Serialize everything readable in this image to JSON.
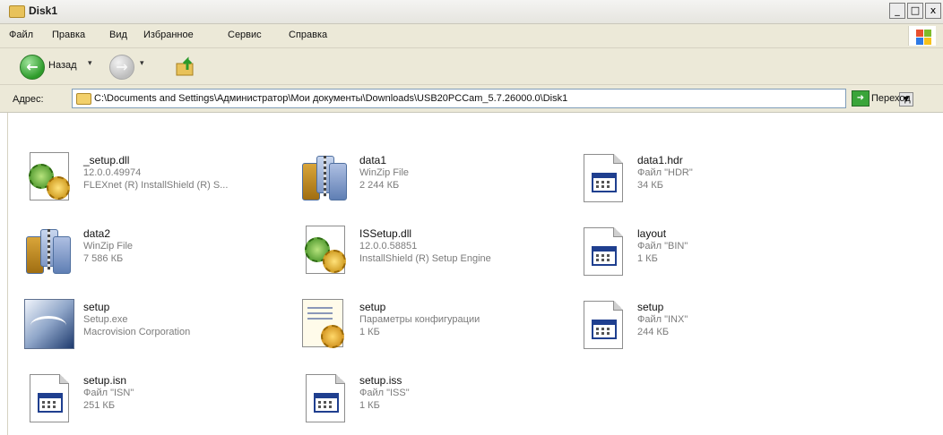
{
  "window": {
    "title": "Disk1",
    "buttons": {
      "minimize": "_",
      "maximize": "□",
      "close": "x"
    }
  },
  "menu": {
    "items": [
      "Файл",
      "Правка",
      "Вид",
      "Избранное",
      "Сервис",
      "Справка"
    ]
  },
  "toolbar": {
    "back_label": "Назад",
    "back_dropdown": "▾",
    "forward_dropdown": "▾"
  },
  "address": {
    "label": "Адрес:",
    "path": "C:\\Documents and Settings\\Администратор\\Мои документы\\Downloads\\USB20PCCam_5.7.26000.0\\Disk1",
    "go_label": "Переход"
  },
  "files": [
    {
      "icon": "dll-gears-icon",
      "name": "_setup.dll",
      "line2": "12.0.0.49974",
      "line3": "FLEXnet (R) InstallShield (R) S..."
    },
    {
      "icon": "winzip-archive-icon",
      "name": "data1",
      "line2": "WinZip File",
      "line3": "2 244 КБ"
    },
    {
      "icon": "generic-file-icon",
      "name": "data1.hdr",
      "line2": "Файл \"HDR\"",
      "line3": "34 КБ"
    },
    {
      "icon": "winzip-archive-icon",
      "name": "data2",
      "line2": "WinZip File",
      "line3": "7 586 КБ"
    },
    {
      "icon": "dll-gears-icon",
      "name": "ISSetup.dll",
      "line2": "12.0.0.58851",
      "line3": "InstallShield (R) Setup Engine"
    },
    {
      "icon": "generic-file-icon",
      "name": "layout",
      "line2": "Файл \"BIN\"",
      "line3": "1 КБ"
    },
    {
      "icon": "setup-exe-icon",
      "name": "setup",
      "line2": "Setup.exe",
      "line3": "Macrovision Corporation"
    },
    {
      "icon": "config-settings-icon",
      "name": "setup",
      "line2": "Параметры конфигурации",
      "line3": "1 КБ"
    },
    {
      "icon": "generic-file-icon",
      "name": "setup",
      "line2": "Файл \"INX\"",
      "line3": "244 КБ"
    },
    {
      "icon": "generic-file-icon",
      "name": "setup.isn",
      "line2": "Файл \"ISN\"",
      "line3": "251 КБ"
    },
    {
      "icon": "generic-file-icon",
      "name": "setup.iss",
      "line2": "Файл \"ISS\"",
      "line3": "1 КБ"
    }
  ]
}
